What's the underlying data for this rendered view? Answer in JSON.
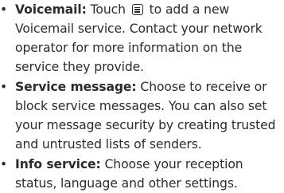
{
  "items": [
    {
      "bullet": "•",
      "term": "Voicemail:",
      "text_before_icon": "Touch",
      "icon": "menu-icon",
      "text_after_icon": "to add a new Voicemail service. Contact your network operator for more information on the service they provide."
    },
    {
      "bullet": "•",
      "term": "Service message:",
      "text": "Choose to receive or block service messages. You can also set your message security by creating trusted and untrusted lists of senders."
    },
    {
      "bullet": "•",
      "term": "Info service:",
      "text": "Choose your reception status, language and other settings."
    }
  ],
  "colors": {
    "text": "#2c2c2c",
    "background": "#ffffff"
  }
}
